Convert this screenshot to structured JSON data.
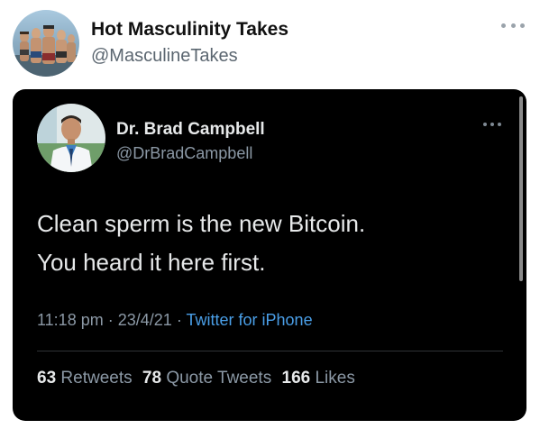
{
  "outer": {
    "name": "Hot Masculinity Takes",
    "handle": "@MasculineTakes"
  },
  "tweet": {
    "author_name": "Dr. Brad Campbell",
    "author_handle": "@DrBradCampbell",
    "text_lines": [
      "Clean sperm is the new Bitcoin.",
      "You heard it here first."
    ],
    "time": "11:18 pm",
    "date": "23/4/21",
    "separator": "·",
    "source": "Twitter for iPhone",
    "stats": [
      {
        "count": "63",
        "label": "Retweets"
      },
      {
        "count": "78",
        "label": "Quote Tweets"
      },
      {
        "count": "166",
        "label": "Likes"
      }
    ]
  },
  "colors": {
    "card_background": "#000000",
    "link_blue": "#4a9fe8",
    "secondary_text": "#8b98a5"
  }
}
